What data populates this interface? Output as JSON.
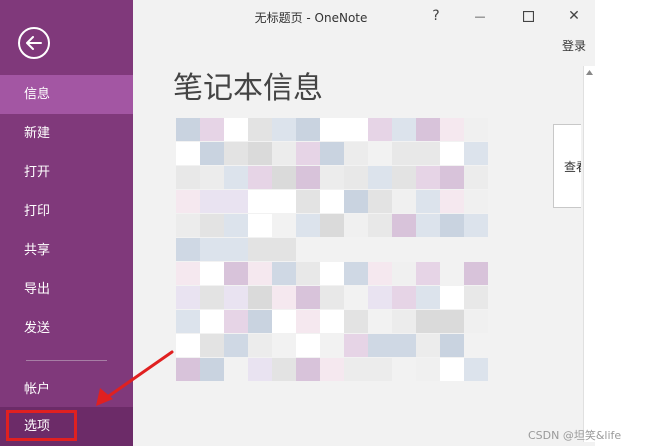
{
  "window": {
    "title": "无标题页 - OneNote",
    "help_glyph": "?",
    "minimize_glyph": "—",
    "close_glyph": "✕"
  },
  "sidebar": {
    "back_icon": "back-arrow-icon",
    "items": [
      {
        "label": "信息",
        "selected": true
      },
      {
        "label": "新建"
      },
      {
        "label": "打开"
      },
      {
        "label": "打印"
      },
      {
        "label": "共享"
      },
      {
        "label": "导出"
      },
      {
        "label": "发送"
      },
      {
        "label": "帐户"
      },
      {
        "label": "选项"
      }
    ]
  },
  "header": {
    "signin_label": "登录"
  },
  "main": {
    "heading": "笔记本信息",
    "view_button_label": "查看"
  },
  "watermark": {
    "text": "CSDN @坦笑&life"
  },
  "colors": {
    "sidebar_bg": "#80397b",
    "sidebar_selected": "#a356a3",
    "options_bg": "#6c2b68",
    "highlight_red": "#e02020",
    "content_bg": "#f2f2f2"
  }
}
